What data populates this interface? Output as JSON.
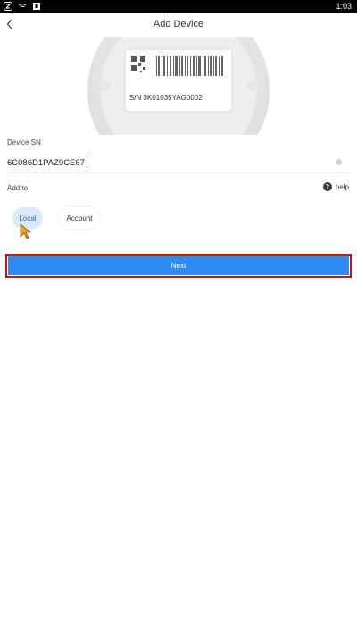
{
  "status_bar": {
    "time": "1:03",
    "icons": [
      "vpn-icon",
      "signal-icon",
      "app-icon"
    ]
  },
  "header": {
    "back_icon": "chevron-left-icon",
    "title": "Add Device"
  },
  "device_image": {
    "sn_text": "S/N  3K01035YAG0002"
  },
  "form": {
    "sn_label": "Device SN",
    "sn_value": "6C086D1PAZ9CE67",
    "add_to_label": "Add to",
    "help_label": "help",
    "options": [
      "Local",
      "Account"
    ],
    "selected_option": "Local"
  },
  "actions": {
    "next_label": "Next"
  },
  "colors": {
    "accent": "#2f8bf3",
    "selected_option_bg": "#dbe9ff",
    "selected_option_text": "#2a6fd6",
    "highlight_outline": "#c01818"
  }
}
